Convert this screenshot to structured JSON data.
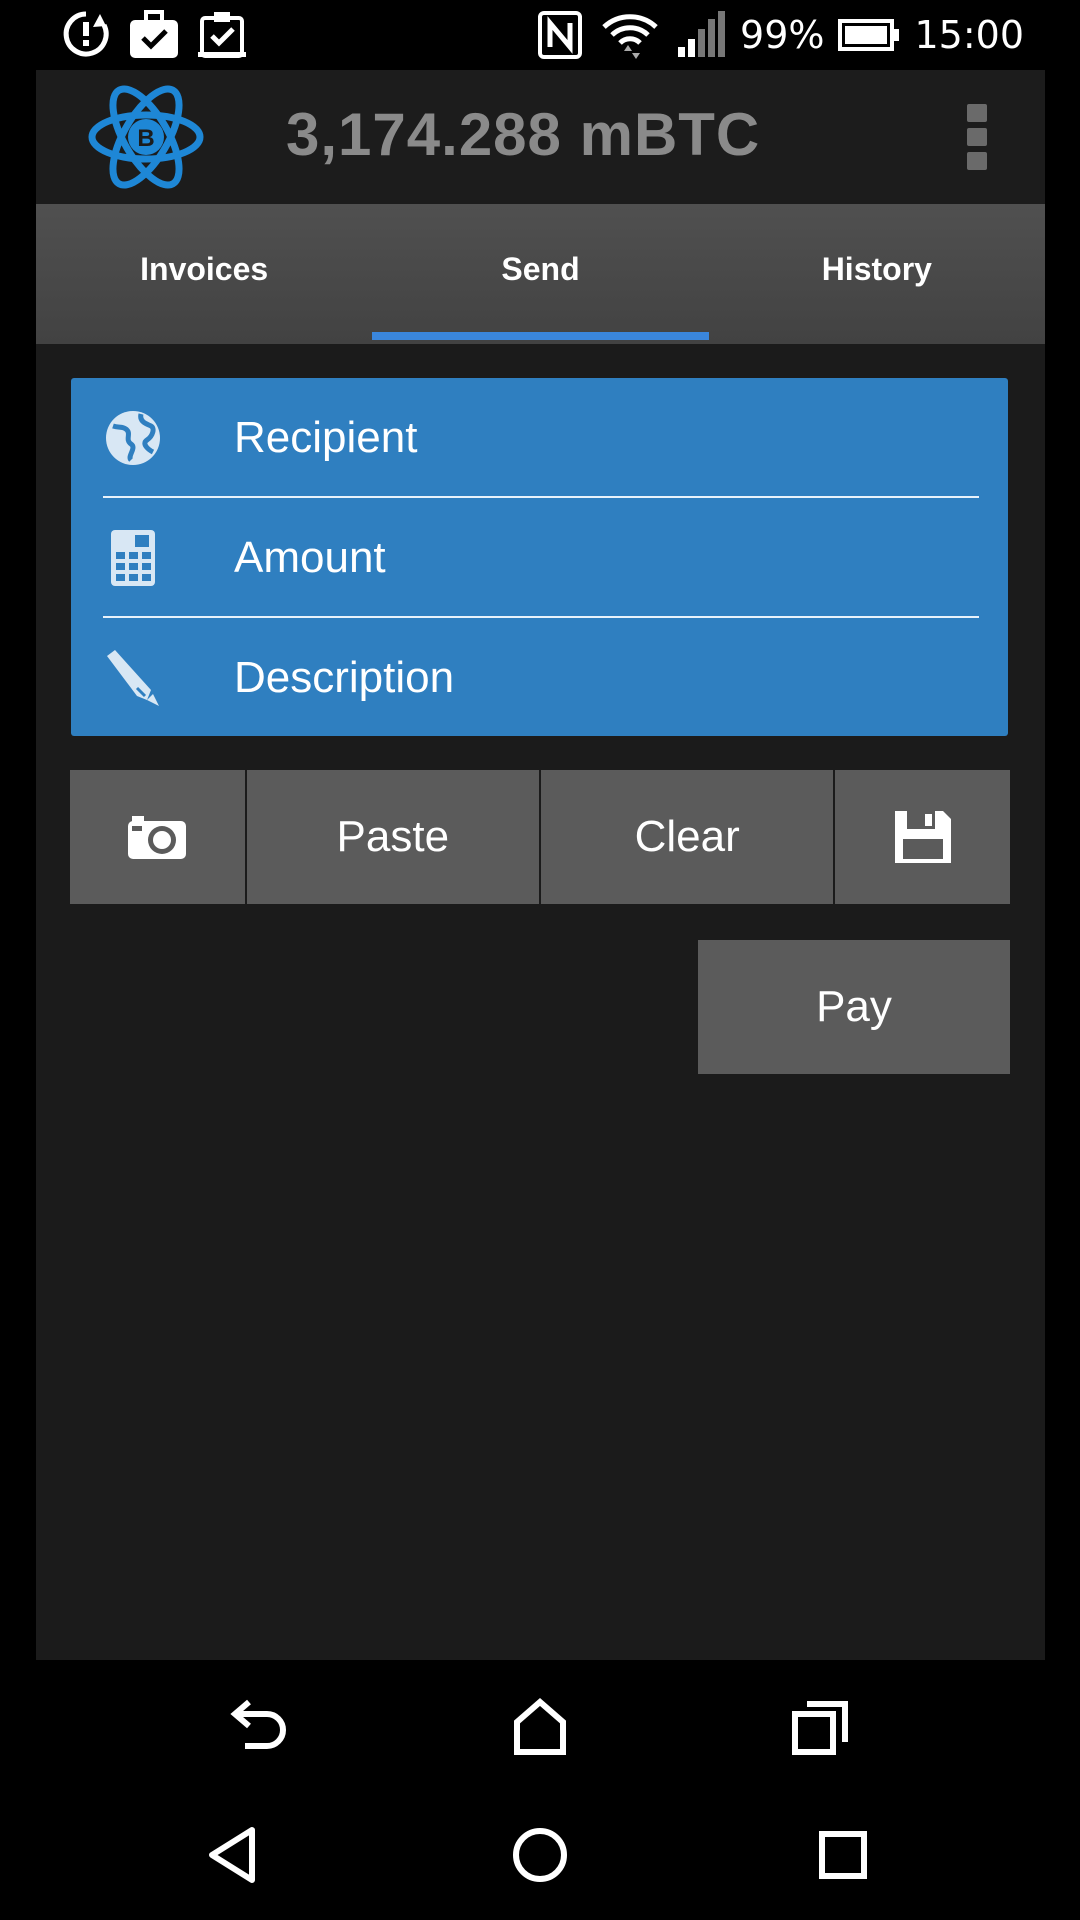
{
  "status_bar": {
    "left_icons": [
      "sync-alert-icon",
      "briefcase-check-icon",
      "clipboard-check-icon"
    ],
    "right_icons": [
      "nfc-icon",
      "wifi-icon",
      "signal-icon",
      "battery-icon"
    ],
    "battery": "99%",
    "time": "15:00"
  },
  "header": {
    "logo": "electrum-bitcoin-logo",
    "balance": "3,174.288 mBTC",
    "menu_icon": "overflow-menu-icon"
  },
  "tabs": [
    {
      "label": "Invoices",
      "active": false
    },
    {
      "label": "Send",
      "active": true
    },
    {
      "label": "History",
      "active": false
    }
  ],
  "form": {
    "recipient": {
      "icon": "globe-icon",
      "label": "Recipient"
    },
    "amount": {
      "icon": "calculator-icon",
      "label": "Amount"
    },
    "description": {
      "icon": "pen-icon",
      "label": "Description"
    }
  },
  "actions": {
    "camera_icon": "camera-icon",
    "paste_label": "Paste",
    "clear_label": "Clear",
    "save_icon": "save-icon",
    "pay_label": "Pay"
  },
  "colors": {
    "accent": "#2f7fc0",
    "tab_indicator": "#3a86dc",
    "button": "#5b5b5b",
    "background": "#1b1b1b"
  }
}
